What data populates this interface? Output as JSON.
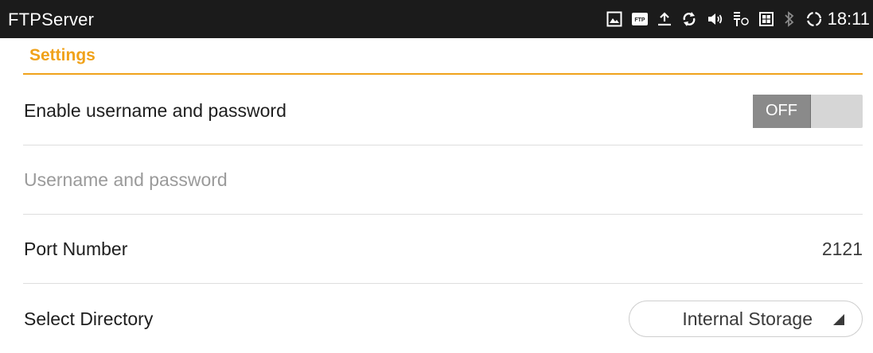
{
  "statusbar": {
    "app_title": "FTPServer",
    "clock": "18:11",
    "icons": [
      "image-icon",
      "ftp-icon",
      "upload-icon",
      "sync-icon",
      "volume-icon",
      "usb-icon",
      "sim-card-icon",
      "bluetooth-icon",
      "loading-icon"
    ],
    "ftp_icon_text": "FTP"
  },
  "settings": {
    "section_title": "Settings",
    "accent_color": "#f0a21a",
    "enable_credentials": {
      "label": "Enable username and password",
      "toggle_state": "OFF"
    },
    "credentials": {
      "label": "Username and password"
    },
    "port": {
      "label": "Port Number",
      "value": "2121"
    },
    "directory": {
      "label": "Select Directory",
      "selected": "Internal Storage"
    }
  }
}
